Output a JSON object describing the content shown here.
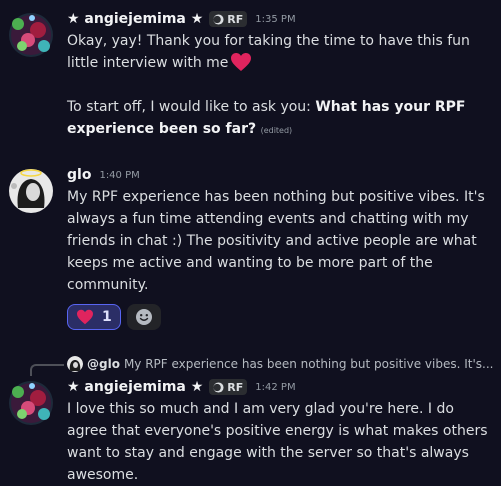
{
  "messages": [
    {
      "username": "★ angiejemima ★",
      "tag": "RF",
      "time": "1:35 PM",
      "line1": "Okay, yay! Thank you for taking the time to have this fun little interview with me",
      "line2_plain": "To start off, I would like to ask you: ",
      "line2_bold": "What has your RPF experience been so far?",
      "edited": "(edited)"
    },
    {
      "username": "glo",
      "time": "1:40 PM",
      "text": "My RPF experience has been nothing but positive vibes. It's always a fun time attending events and chatting with my friends in chat :) The positivity and active people are what keeps me active and wanting to be more part of the community.",
      "reaction_count": "1"
    },
    {
      "reply_name": "@glo",
      "reply_text": "My RPF experience has been nothing but positive vibes. It's...",
      "username": "★ angiejemima ★",
      "tag": "RF",
      "time": "1:42 PM",
      "text": "I love this so much and I am very glad you're here. I do agree that everyone's positive energy is what makes others want to stay and engage with the server so that's always awesome."
    }
  ],
  "colors": {
    "background": "#10101f",
    "reaction_border": "#5865f2",
    "heart": "#e0245e"
  }
}
